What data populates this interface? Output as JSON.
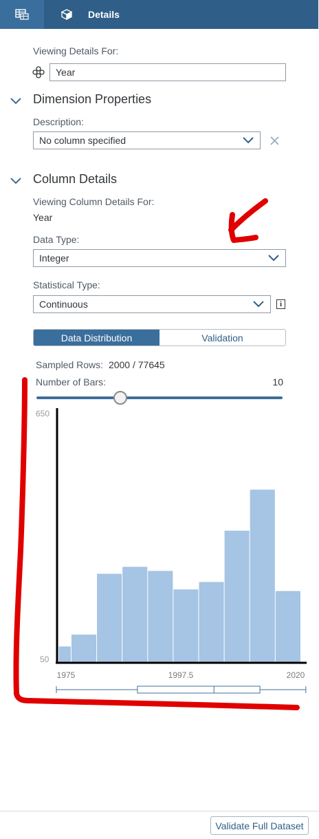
{
  "tabs": {
    "table_icon": "table-icon",
    "details_icon": "cube-icon",
    "details_label": "Details"
  },
  "viewing": {
    "label": "Viewing Details For:",
    "icon": "dimension-icon",
    "value": "Year"
  },
  "dimension_properties": {
    "title": "Dimension Properties",
    "description_label": "Description:",
    "description_value": "No column specified"
  },
  "column_details": {
    "title": "Column Details",
    "viewing_label": "Viewing Column Details For:",
    "viewing_value": "Year",
    "data_type_label": "Data Type:",
    "data_type_value": "Integer",
    "stat_type_label": "Statistical Type:",
    "stat_type_value": "Continuous",
    "info_glyph": "i"
  },
  "segmented": {
    "distribution": "Data Distribution",
    "validation": "Validation",
    "selected": "Data Distribution"
  },
  "sampling": {
    "rows_label": "Sampled Rows:",
    "rows_value": "2000 / 77645",
    "bars_label": "Number of Bars:",
    "bars_value": "10",
    "bars_fraction": 0.34
  },
  "chart_data": {
    "type": "bar",
    "ylim": [
      50,
      650
    ],
    "y_ticks": [
      "650",
      "50"
    ],
    "x_ticks": [
      "1975",
      "1997.5",
      "2020"
    ],
    "xlim": [
      1975,
      2020
    ],
    "bins": [
      {
        "x0": 1971,
        "x1": 1976,
        "value": 78
      },
      {
        "x0": 1976,
        "x1": 1981,
        "value": 107
      },
      {
        "x0": 1981,
        "x1": 1986,
        "value": 255
      },
      {
        "x0": 1986,
        "x1": 1991,
        "value": 272
      },
      {
        "x0": 1991,
        "x1": 1996,
        "value": 262
      },
      {
        "x0": 1996,
        "x1": 2001,
        "value": 217
      },
      {
        "x0": 2001,
        "x1": 2006,
        "value": 235
      },
      {
        "x0": 2006,
        "x1": 2011,
        "value": 360
      },
      {
        "x0": 2011,
        "x1": 2016,
        "value": 460
      },
      {
        "x0": 2016,
        "x1": 2021,
        "value": 213
      }
    ],
    "boxplot": {
      "min": 1973,
      "q1": 1989,
      "median": 2004,
      "q3": 2013,
      "max": 2022
    },
    "bar_color": "#a6c4e4"
  },
  "footer": {
    "validate_label": "Validate Full Dataset"
  },
  "colors": {
    "accent": "#2f5f88",
    "accent_light": "#3a6e9c",
    "annotation": "#e00000"
  }
}
